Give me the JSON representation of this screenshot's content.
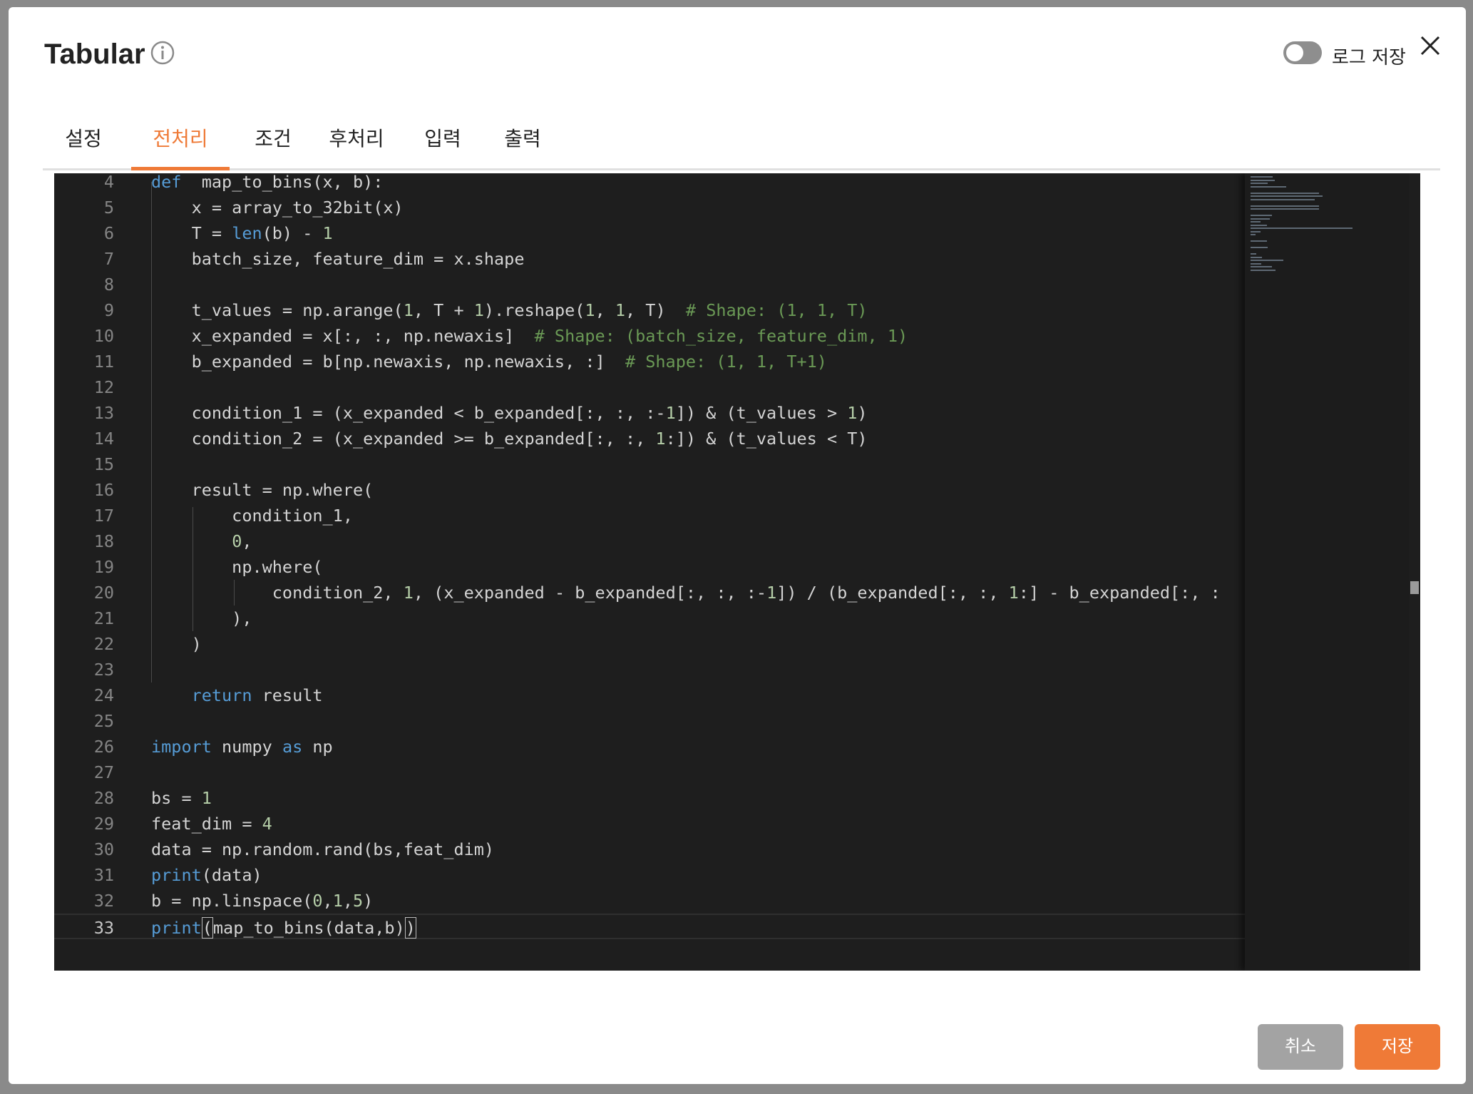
{
  "dialog": {
    "title": "Tabular",
    "log_save_label": "로그 저장",
    "log_save_enabled": false
  },
  "tabs": [
    {
      "label": "설정",
      "active": false
    },
    {
      "label": "전처리",
      "active": true
    },
    {
      "label": "조건",
      "active": false
    },
    {
      "label": "후처리",
      "active": false
    },
    {
      "label": "입력",
      "active": false
    },
    {
      "label": "출력",
      "active": false
    }
  ],
  "editor": {
    "current_line": 33,
    "lines": [
      {
        "n": "4",
        "tokens": [
          [
            "kw",
            "def"
          ],
          [
            "",
            "  map_to_bins(x, b):"
          ]
        ]
      },
      {
        "n": "5",
        "tokens": [
          [
            "",
            "    x = array_to_32bit(x)"
          ]
        ]
      },
      {
        "n": "6",
        "tokens": [
          [
            "",
            "    T = "
          ],
          [
            "fn",
            "len"
          ],
          [
            "",
            "(b) - "
          ],
          [
            "num",
            "1"
          ]
        ]
      },
      {
        "n": "7",
        "tokens": [
          [
            "",
            "    batch_size, feature_dim = x.shape"
          ]
        ]
      },
      {
        "n": "8",
        "tokens": []
      },
      {
        "n": "9",
        "tokens": [
          [
            "",
            "    t_values = np.arange("
          ],
          [
            "num",
            "1"
          ],
          [
            "",
            ", T + "
          ],
          [
            "num",
            "1"
          ],
          [
            "",
            ").reshape("
          ],
          [
            "num",
            "1"
          ],
          [
            "",
            ", "
          ],
          [
            "num",
            "1"
          ],
          [
            "",
            ", T)  "
          ],
          [
            "cm",
            "# Shape: (1, 1, T)"
          ]
        ]
      },
      {
        "n": "10",
        "tokens": [
          [
            "",
            "    x_expanded = x[:, :, np.newaxis]  "
          ],
          [
            "cm",
            "# Shape: (batch_size, feature_dim, 1)"
          ]
        ]
      },
      {
        "n": "11",
        "tokens": [
          [
            "",
            "    b_expanded = b[np.newaxis, np.newaxis, :]  "
          ],
          [
            "cm",
            "# Shape: (1, 1, T+1)"
          ]
        ]
      },
      {
        "n": "12",
        "tokens": []
      },
      {
        "n": "13",
        "tokens": [
          [
            "",
            "    condition_1 = (x_expanded < b_expanded[:, :, :-"
          ],
          [
            "num",
            "1"
          ],
          [
            "",
            "]) & (t_values > "
          ],
          [
            "num",
            "1"
          ],
          [
            "",
            ")"
          ]
        ]
      },
      {
        "n": "14",
        "tokens": [
          [
            "",
            "    condition_2 = (x_expanded >= b_expanded[:, :, "
          ],
          [
            "num",
            "1"
          ],
          [
            "",
            ":]) & (t_values < T)"
          ]
        ]
      },
      {
        "n": "15",
        "tokens": []
      },
      {
        "n": "16",
        "tokens": [
          [
            "",
            "    result = np.where("
          ]
        ]
      },
      {
        "n": "17",
        "tokens": [
          [
            "",
            "        condition_1,"
          ]
        ]
      },
      {
        "n": "18",
        "tokens": [
          [
            "",
            "        "
          ],
          [
            "num",
            "0"
          ],
          [
            "",
            ","
          ]
        ]
      },
      {
        "n": "19",
        "tokens": [
          [
            "",
            "        np.where("
          ]
        ]
      },
      {
        "n": "20",
        "tokens": [
          [
            "",
            "            condition_2, "
          ],
          [
            "num",
            "1"
          ],
          [
            "",
            ", (x_expanded - b_expanded[:, :, :-"
          ],
          [
            "num",
            "1"
          ],
          [
            "",
            "]) / (b_expanded[:, :, "
          ],
          [
            "num",
            "1"
          ],
          [
            "",
            ":] - b_expanded[:, :"
          ]
        ]
      },
      {
        "n": "21",
        "tokens": [
          [
            "",
            "        ),"
          ]
        ]
      },
      {
        "n": "22",
        "tokens": [
          [
            "",
            "    )"
          ]
        ]
      },
      {
        "n": "23",
        "tokens": []
      },
      {
        "n": "24",
        "tokens": [
          [
            "",
            "    "
          ],
          [
            "kw",
            "return"
          ],
          [
            "",
            " result"
          ]
        ]
      },
      {
        "n": "25",
        "tokens": []
      },
      {
        "n": "26",
        "tokens": [
          [
            "kw",
            "import"
          ],
          [
            "",
            " numpy "
          ],
          [
            "kw",
            "as"
          ],
          [
            "",
            " np"
          ]
        ]
      },
      {
        "n": "27",
        "tokens": []
      },
      {
        "n": "28",
        "tokens": [
          [
            "",
            "bs = "
          ],
          [
            "num",
            "1"
          ]
        ]
      },
      {
        "n": "29",
        "tokens": [
          [
            "",
            "feat_dim = "
          ],
          [
            "num",
            "4"
          ]
        ]
      },
      {
        "n": "30",
        "tokens": [
          [
            "",
            "data = np.random.rand(bs,feat_dim)"
          ]
        ]
      },
      {
        "n": "31",
        "tokens": [
          [
            "fn",
            "print"
          ],
          [
            "",
            "(data)"
          ]
        ]
      },
      {
        "n": "32",
        "tokens": [
          [
            "",
            "b = np.linspace("
          ],
          [
            "num",
            "0"
          ],
          [
            "",
            ","
          ],
          [
            "num",
            "1"
          ],
          [
            "",
            ","
          ],
          [
            "num",
            "5"
          ],
          [
            "",
            ")"
          ]
        ]
      },
      {
        "n": "33",
        "tokens": [
          [
            "fn",
            "print"
          ],
          [
            "caret",
            "("
          ],
          [
            "",
            "map_to_bins(data,b)"
          ],
          [
            "caret",
            ")"
          ]
        ]
      }
    ]
  },
  "footer": {
    "cancel_label": "취소",
    "save_label": "저장"
  },
  "colors": {
    "accent": "#ef7a37",
    "editor_bg": "#1e1e1e",
    "keyword": "#569cd6",
    "number": "#b5cea8",
    "comment": "#6a9955"
  }
}
